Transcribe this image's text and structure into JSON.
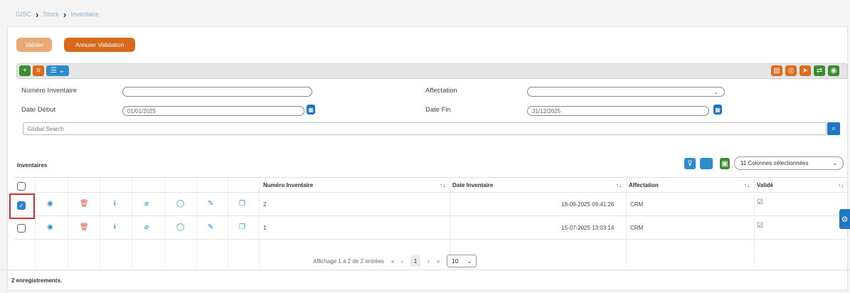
{
  "breadcrumb": [
    "GISC",
    "Stock",
    "Inventaire"
  ],
  "buttons": {
    "valider": "Valider",
    "annuler": "Annuler Validation"
  },
  "toolbar": {
    "add": "+",
    "list": "≡",
    "view": "☰"
  },
  "form": {
    "numero_label": "Numéro Inventaire",
    "numero_value": "",
    "affectation_label": "Affectation",
    "affectation_value": "",
    "date_debut_label": "Date Début",
    "date_debut_value": "01/01/2025",
    "date_fin_label": "Date Fin",
    "date_fin_value": "31/12/2025",
    "search_placeholder": "Global Search"
  },
  "table": {
    "title": "Inventaires",
    "columns_selector": "11 Colonnes sélectionnées",
    "headers": {
      "numero": "Numéro Inventaire",
      "date": "Date Inventaire",
      "affectation": "Affectation",
      "valide": "Validé"
    },
    "rows": [
      {
        "numero": "2",
        "date": "18-09-2025 09:41:26",
        "affectation": "CRM",
        "selected": true
      },
      {
        "numero": "1",
        "date": "15-07-2025 13:03:14",
        "affectation": "CRM",
        "selected": false
      }
    ]
  },
  "pagination": {
    "info": "Affichage 1 à 2 de 2 entrées",
    "first": "«",
    "prev": "‹",
    "page": "1",
    "next": "›",
    "last": "»",
    "rows": "10"
  },
  "footer": {
    "count": "2 enregistrements."
  },
  "colors": {
    "orange": "#e07b28",
    "blue": "#1f76c2",
    "green": "#3c8d2f",
    "highlight": "#d32f2f"
  }
}
